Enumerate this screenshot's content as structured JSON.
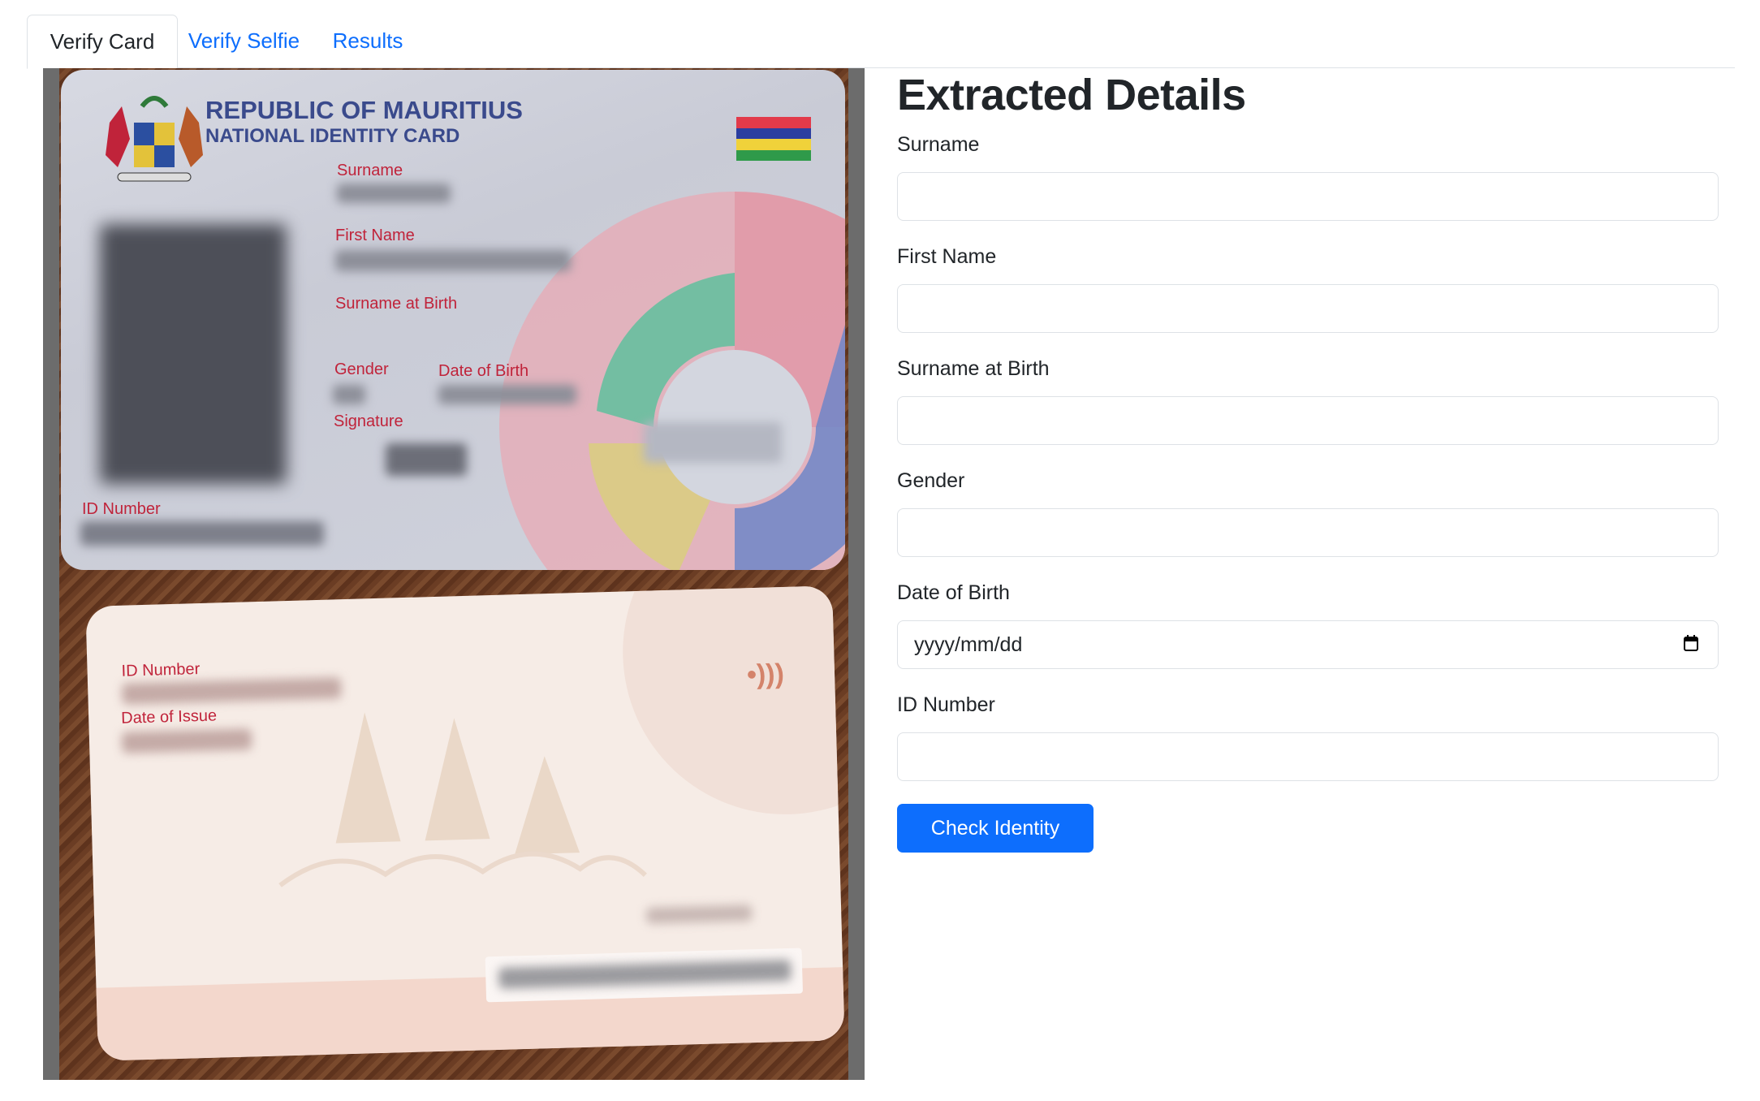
{
  "tabs": [
    {
      "label": "Verify Card",
      "active": true
    },
    {
      "label": "Verify Selfie",
      "active": false
    },
    {
      "label": "Results",
      "active": false
    }
  ],
  "card_front": {
    "header_line1": "REPUBLIC OF MAURITIUS",
    "header_line2": "NATIONAL IDENTITY CARD",
    "field_surname": "Surname",
    "field_first_name": "First Name",
    "field_surname_birth": "Surname at Birth",
    "field_gender": "Gender",
    "field_dob": "Date of Birth",
    "field_signature": "Signature",
    "field_id_number": "ID Number"
  },
  "card_back": {
    "field_id_number": "ID Number",
    "field_date_issue": "Date of Issue"
  },
  "form": {
    "heading": "Extracted Details",
    "fields": [
      {
        "label": "Surname",
        "value": ""
      },
      {
        "label": "First Name",
        "value": ""
      },
      {
        "label": "Surname at Birth",
        "value": ""
      },
      {
        "label": "Gender",
        "value": ""
      },
      {
        "label": "Date of Birth",
        "placeholder": "yyyy/mm/dd"
      },
      {
        "label": "ID Number",
        "value": ""
      }
    ],
    "submit_label": "Check Identity"
  },
  "colors": {
    "accent": "#0d6efd",
    "card_red": "#c0233a",
    "card_title_blue": "#3a4a8c"
  },
  "icons": {
    "calendar": "calendar-icon"
  }
}
